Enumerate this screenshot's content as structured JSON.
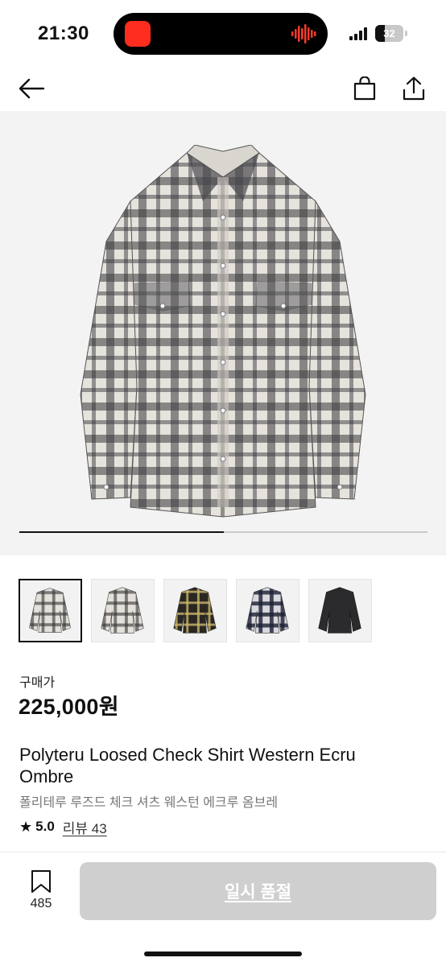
{
  "status_bar": {
    "time": "21:30",
    "battery_level": "32",
    "icons": [
      "recording-icon",
      "audio-wave-icon",
      "signal-icon",
      "battery-icon"
    ]
  },
  "nav": {
    "icons": [
      "back-arrow-icon",
      "shopping-bag-icon",
      "share-icon"
    ]
  },
  "gallery": {
    "progress": 0.5,
    "thumbnail_count": 5,
    "selected_index": 0
  },
  "product": {
    "price_label": "구매가",
    "price": "225,000원",
    "title_en": "Polyteru Loosed Check Shirt Western Ecru Ombre",
    "title_ko": "폴리테루 루즈드 체크 셔츠 웨스턴 에크루 옴브레",
    "rating": "5.0",
    "review_label": "리뷰 43"
  },
  "bottom_bar": {
    "bookmark_count": "485",
    "buy_button_label": "일시 품절"
  },
  "colors": {
    "accent": "#111111",
    "disabled_button": "#cfcfcf",
    "hero_bg": "#f3f3f3",
    "recording_red": "#ff2d1f"
  }
}
